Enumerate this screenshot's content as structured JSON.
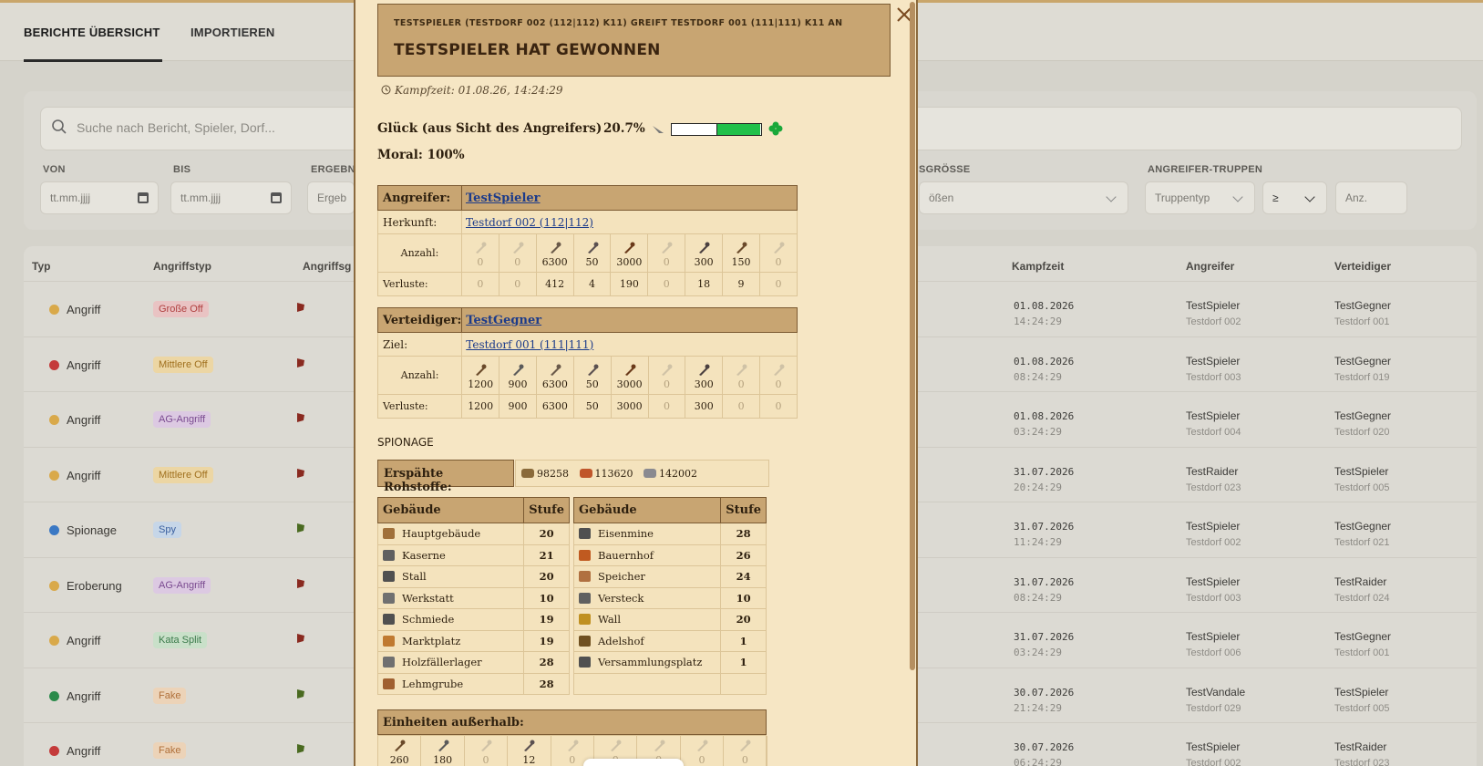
{
  "tabs": [
    "BERICHTE ÜBERSICHT",
    "IMPORTIEREN"
  ],
  "search": {
    "placeholder": "Suche nach Bericht, Spieler, Dorf..."
  },
  "filters": {
    "von": {
      "label": "VON",
      "value": "tt.mm.jjjj"
    },
    "bis": {
      "label": "BIS",
      "value": "tt.mm.jjjj"
    },
    "ergebnis": {
      "label": "ERGEBNI",
      "value": "Ergeb"
    },
    "groesse": {
      "label": "SGRÖSSE",
      "value": "ößen"
    },
    "truppen": {
      "label": "ANGREIFER-TRUPPEN",
      "type": "Truppentyp",
      "op": "≥",
      "anz": "Anz."
    }
  },
  "columns": [
    "Typ",
    "Angriffstyp",
    "Angriffsg",
    "Kampfzeit",
    "Angreifer",
    "Verteidiger"
  ],
  "rows": [
    {
      "typ": "Angriff",
      "dot": "#d9a94a",
      "badge": "Große Off",
      "badge_bg": "#e9c3c3",
      "badge_fg": "#b04040",
      "flag": "#8a2a20",
      "date": "01.08.2026",
      "time": "14:24:29",
      "att": "TestSpieler",
      "att_v": "Testdorf 002",
      "def": "TestGegner",
      "def_v": "Testdorf 001"
    },
    {
      "typ": "Angriff",
      "dot": "#c43a3a",
      "badge": "Mittlere Off",
      "badge_bg": "#ecd6a4",
      "badge_fg": "#a0701e",
      "flag": "#8a2a20",
      "date": "01.08.2026",
      "time": "08:24:29",
      "att": "TestSpieler",
      "att_v": "Testdorf 003",
      "def": "TestGegner",
      "def_v": "Testdorf 019"
    },
    {
      "typ": "Angriff",
      "dot": "#d9a94a",
      "badge": "AG-Angriff",
      "badge_bg": "#dcc9e2",
      "badge_fg": "#7a4a90",
      "flag": "#8a2a20",
      "date": "01.08.2026",
      "time": "03:24:29",
      "att": "TestSpieler",
      "att_v": "Testdorf 004",
      "def": "TestGegner",
      "def_v": "Testdorf 020"
    },
    {
      "typ": "Angriff",
      "dot": "#d9a94a",
      "badge": "Mittlere Off",
      "badge_bg": "#ecd6a4",
      "badge_fg": "#a0701e",
      "flag": "#8a2a20",
      "date": "31.07.2026",
      "time": "20:24:29",
      "att": "TestRaider",
      "att_v": "Testdorf 023",
      "def": "TestSpieler",
      "def_v": "Testdorf 005"
    },
    {
      "typ": "Spionage",
      "dot": "#3a78c4",
      "badge": "Spy",
      "badge_bg": "#c6d6e8",
      "badge_fg": "#3a60a0",
      "flag": "#4a6a20",
      "date": "31.07.2026",
      "time": "11:24:29",
      "att": "TestSpieler",
      "att_v": "Testdorf 002",
      "def": "TestGegner",
      "def_v": "Testdorf 021"
    },
    {
      "typ": "Eroberung",
      "dot": "#d9a94a",
      "badge": "AG-Angriff",
      "badge_bg": "#dcc9e2",
      "badge_fg": "#7a4a90",
      "flag": "#8a2a20",
      "date": "31.07.2026",
      "time": "08:24:29",
      "att": "TestSpieler",
      "att_v": "Testdorf 003",
      "def": "TestRaider",
      "def_v": "Testdorf 024"
    },
    {
      "typ": "Angriff",
      "dot": "#d9a94a",
      "badge": "Kata Split",
      "badge_bg": "#c9e0c9",
      "badge_fg": "#3a7a4a",
      "flag": "#8a2a20",
      "date": "31.07.2026",
      "time": "03:24:29",
      "att": "TestSpieler",
      "att_v": "Testdorf 006",
      "def": "TestGegner",
      "def_v": "Testdorf 001"
    },
    {
      "typ": "Angriff",
      "dot": "#2a8a4a",
      "badge": "Fake",
      "badge_bg": "#ecd3b8",
      "badge_fg": "#b0703a",
      "flag": "#4a6a20",
      "date": "30.07.2026",
      "time": "21:24:29",
      "att": "TestVandale",
      "att_v": "Testdorf 029",
      "def": "TestSpieler",
      "def_v": "Testdorf 005"
    },
    {
      "typ": "Angriff",
      "dot": "#c43a3a",
      "badge": "Fake",
      "badge_bg": "#ecd3b8",
      "badge_fg": "#b0703a",
      "flag": "#4a6a20",
      "date": "30.07.2026",
      "time": "06:24:29",
      "att": "TestSpieler",
      "att_v": "Testdorf 002",
      "def": "TestRaider",
      "def_v": "Testdorf 023"
    }
  ],
  "report": {
    "subtitle": "TESTSPIELER (TESTDORF 002 (112|112) K11) GREIFT TESTDORF 001 (111|111) K11 AN",
    "title": "TESTSPIELER HAT GEWONNEN",
    "time": "Kampfzeit: 01.08.26, 14:24:29",
    "luck_label": "Glück (aus Sicht des Angreifers)",
    "luck_value": "20.7%",
    "luck_fraction": 0.207,
    "moral": "Moral: 100%",
    "attacker": {
      "label": "Angreifer:",
      "name": "TestSpieler",
      "origin_label": "Herkunft:",
      "origin": "Testdorf 002 (112|112)",
      "count_label": "Anzahl:",
      "loss_label": "Verluste:",
      "counts": [
        "0",
        "0",
        "6300",
        "50",
        "3000",
        "0",
        "300",
        "150",
        "0"
      ],
      "losses": [
        "0",
        "0",
        "412",
        "4",
        "190",
        "0",
        "18",
        "9",
        "0"
      ]
    },
    "defender": {
      "label": "Verteidiger:",
      "name": "TestGegner",
      "origin_label": "Ziel:",
      "origin": "Testdorf 001 (111|111)",
      "count_label": "Anzahl:",
      "loss_label": "Verluste:",
      "counts": [
        "1200",
        "900",
        "6300",
        "50",
        "3000",
        "0",
        "300",
        "0",
        "0"
      ],
      "losses": [
        "1200",
        "900",
        "6300",
        "50",
        "3000",
        "0",
        "300",
        "0",
        "0"
      ]
    },
    "spy_title": "SPIONAGE",
    "res_label": "Erspähte Rohstoffe:",
    "resources": [
      "98258",
      "113620",
      "142002"
    ],
    "bld_head": [
      "Gebäude",
      "Stufe"
    ],
    "buildings_left": [
      {
        "name": "Hauptgebäude",
        "level": "20",
        "icon": "#a0703a"
      },
      {
        "name": "Kaserne",
        "level": "21",
        "icon": "#606060"
      },
      {
        "name": "Stall",
        "level": "20",
        "icon": "#505050"
      },
      {
        "name": "Werkstatt",
        "level": "10",
        "icon": "#707070"
      },
      {
        "name": "Schmiede",
        "level": "19",
        "icon": "#505050"
      },
      {
        "name": "Marktplatz",
        "level": "19",
        "icon": "#c07a30"
      },
      {
        "name": "Holzfällerlager",
        "level": "28",
        "icon": "#707070"
      },
      {
        "name": "Lehmgrube",
        "level": "28",
        "icon": "#a06030"
      }
    ],
    "buildings_right": [
      {
        "name": "Eisenmine",
        "level": "28",
        "icon": "#505050"
      },
      {
        "name": "Bauernhof",
        "level": "26",
        "icon": "#c05a20"
      },
      {
        "name": "Speicher",
        "level": "24",
        "icon": "#b07040"
      },
      {
        "name": "Versteck",
        "level": "10",
        "icon": "#606060"
      },
      {
        "name": "Wall",
        "level": "20",
        "icon": "#c09020"
      },
      {
        "name": "Adelshof",
        "level": "1",
        "icon": "#705020"
      },
      {
        "name": "Versammlungsplatz",
        "level": "1",
        "icon": "#505050"
      }
    ],
    "outside_label": "Einheiten außerhalb:",
    "outside": [
      "260",
      "180",
      "0",
      "12",
      "0",
      "0",
      "0",
      "0",
      "0"
    ]
  }
}
